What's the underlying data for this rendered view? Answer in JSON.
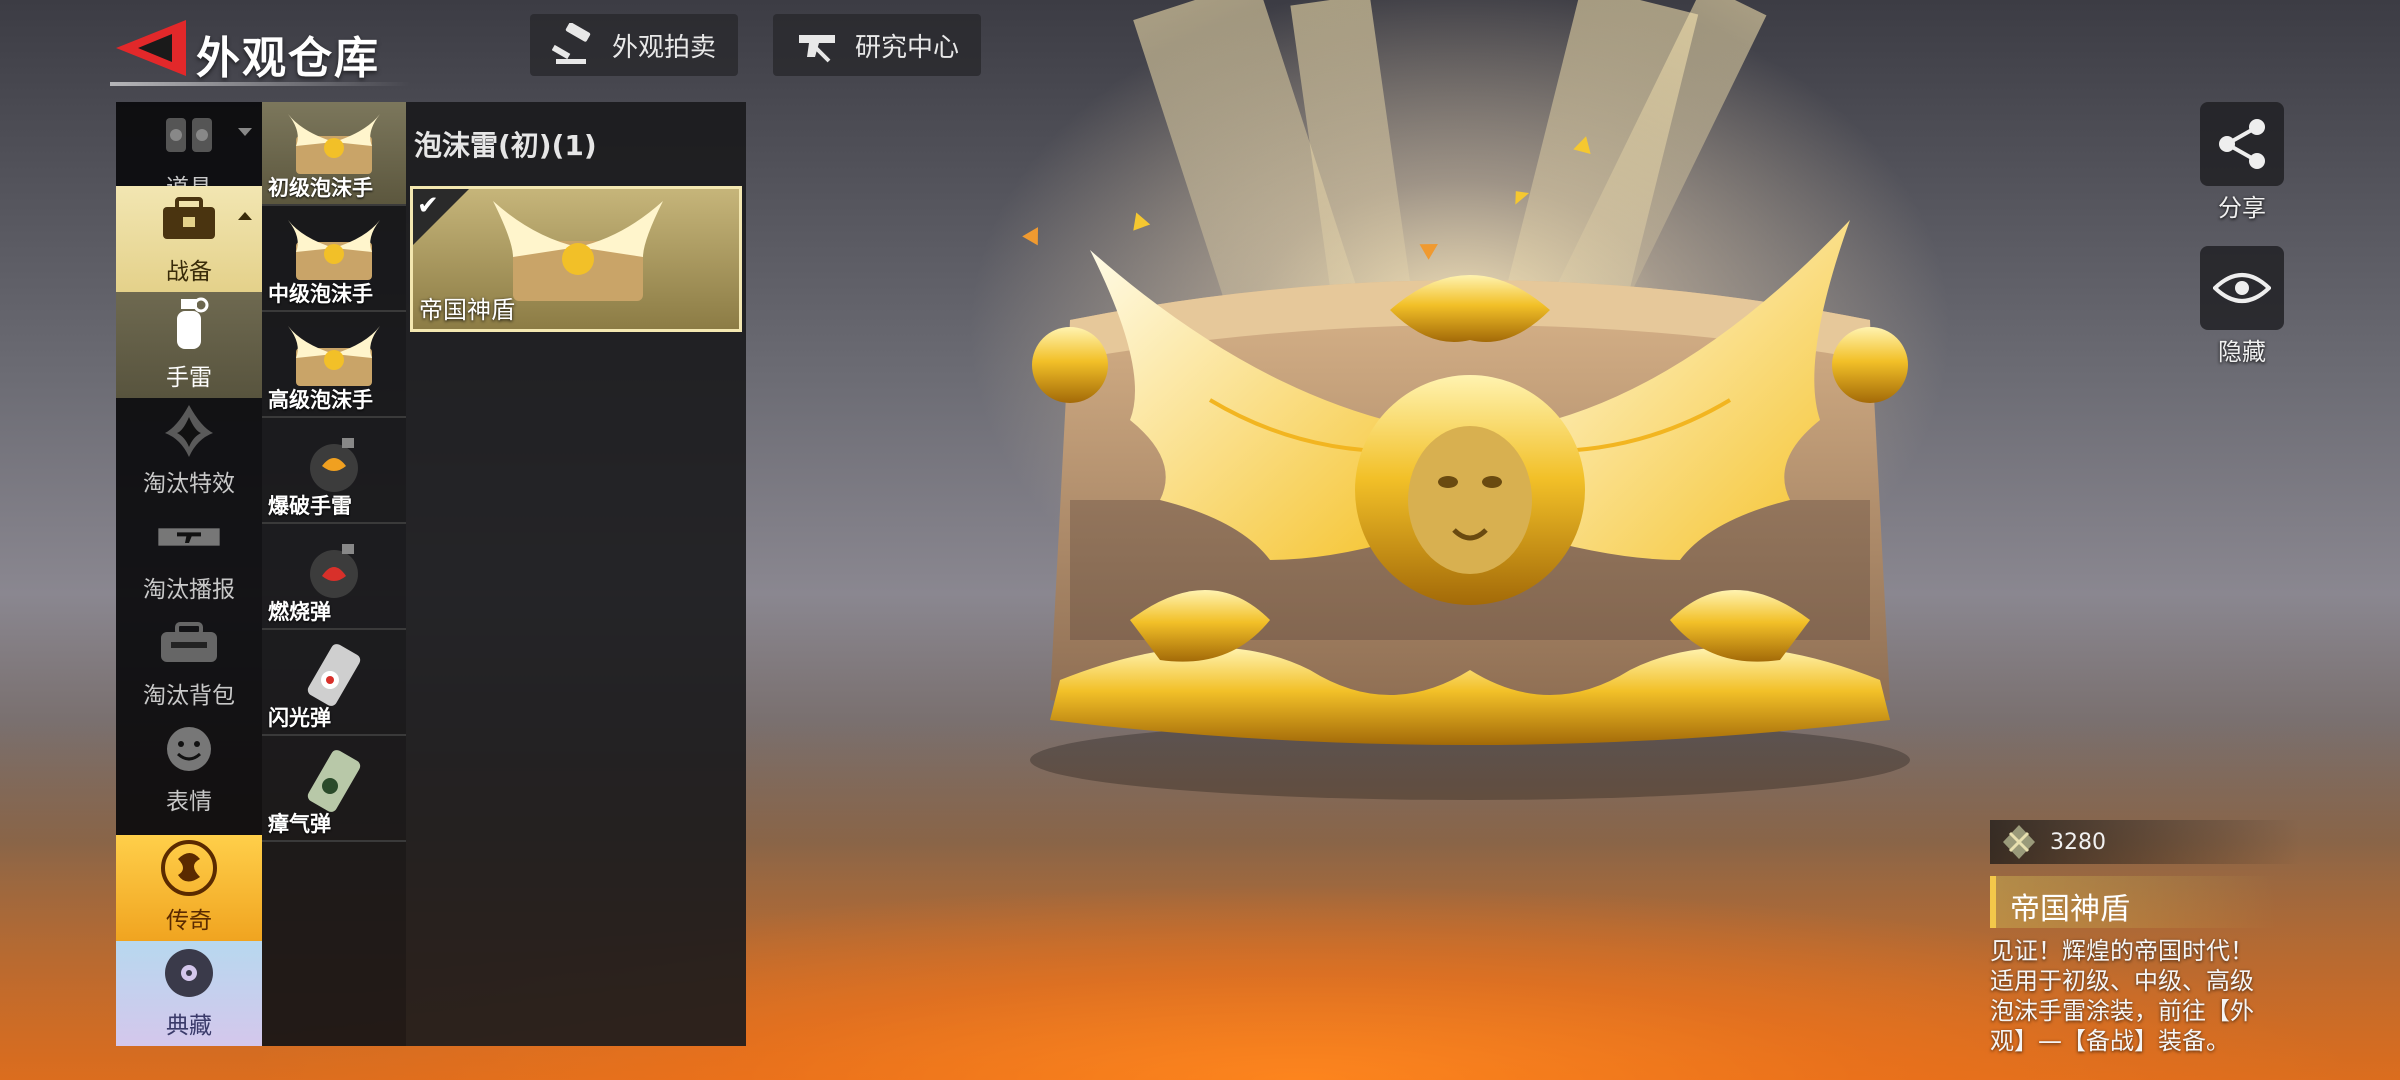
{
  "header": {
    "title": "外观仓库",
    "auction_label": "外观拍卖",
    "research_label": "研究中心"
  },
  "categories": [
    {
      "label": "道具",
      "icon": "props-icon"
    },
    {
      "label": "战备",
      "icon": "supply-box-icon"
    },
    {
      "label": "手雷",
      "icon": "grenade-icon"
    },
    {
      "label": "淘汰特效",
      "icon": "elimination-effect-icon"
    },
    {
      "label": "淘汰播报",
      "icon": "elimination-broadcast-icon"
    },
    {
      "label": "淘汰背包",
      "icon": "elimination-backpack-icon"
    },
    {
      "label": "表情",
      "icon": "emote-icon"
    },
    {
      "label": "传奇",
      "icon": "legend-dragon-icon"
    },
    {
      "label": "典藏",
      "icon": "collection-disc-icon"
    }
  ],
  "subitems": [
    {
      "label": "初级泡沫手"
    },
    {
      "label": "中级泡沫手"
    },
    {
      "label": "高级泡沫手"
    },
    {
      "label": "爆破手雷"
    },
    {
      "label": "燃烧弹"
    },
    {
      "label": "闪光弹"
    },
    {
      "label": "瘴气弹"
    }
  ],
  "items_panel": {
    "group_title": "泡沫雷(初)(1)",
    "items": [
      {
        "name": "帝国神盾",
        "checked": true
      }
    ]
  },
  "side": {
    "share_label": "分享",
    "hide_label": "隐藏"
  },
  "detail": {
    "price": "3280",
    "name": "帝国神盾",
    "desc_lines": [
      "见证！辉煌的帝国时代！",
      "适用于初级、中级、高级",
      "泡沫手雷涂装，前往【外",
      "观】—【备战】装备。"
    ]
  },
  "colors": {
    "accent_red": "#e2282a",
    "gold": "#f3c84a",
    "legend_orange": "#f0a420"
  }
}
